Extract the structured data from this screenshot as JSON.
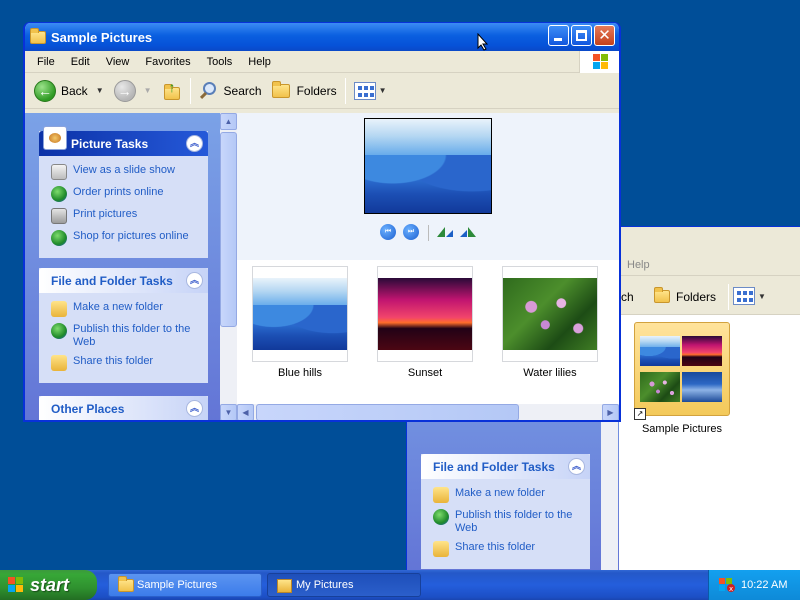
{
  "front_window": {
    "title": "Sample Pictures",
    "menu": [
      "File",
      "Edit",
      "View",
      "Favorites",
      "Tools",
      "Help"
    ],
    "toolbar": {
      "back_label": "Back",
      "search_label": "Search",
      "folders_label": "Folders"
    },
    "picture_tasks": {
      "header": "Picture Tasks",
      "items": [
        "View as a slide show",
        "Order prints online",
        "Print pictures",
        "Shop for pictures online"
      ]
    },
    "file_folder_tasks": {
      "header": "File and Folder Tasks",
      "items": [
        "Make a new folder",
        "Publish this folder to the Web",
        "Share this folder"
      ]
    },
    "other_places": {
      "header": "Other Places"
    },
    "thumbnails": [
      {
        "label": "Blue hills",
        "style": "hills"
      },
      {
        "label": "Sunset",
        "style": "sunset"
      },
      {
        "label": "Water lilies",
        "style": "lilies"
      }
    ]
  },
  "back_window": {
    "menu_help": "Help",
    "toolbar": {
      "search_partial": "rch",
      "folders_label": "Folders"
    },
    "file_folder_tasks": {
      "header": "File and Folder Tasks",
      "items": [
        "Make a new folder",
        "Publish this folder to the Web",
        "Share this folder"
      ]
    },
    "folder_item": {
      "label": "Sample Pictures"
    }
  },
  "taskbar": {
    "start_label": "start",
    "tasks": [
      {
        "label": "Sample Pictures",
        "active": false
      },
      {
        "label": "My Pictures",
        "active": true
      }
    ],
    "clock": "10:22 AM"
  },
  "colors": {
    "desktop": "#004e98",
    "title_bar": "#0a5fe0",
    "task_link": "#215dc6",
    "start_green": "#37a737"
  }
}
